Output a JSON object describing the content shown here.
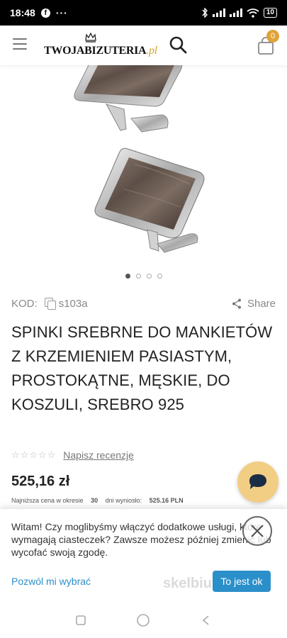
{
  "status": {
    "time": "18:48",
    "fb": "f",
    "more": "···",
    "battery": "10"
  },
  "header": {
    "logo": "TWOJABIZUTERIA",
    "logo_suffix": ".pl",
    "cart_count": "0"
  },
  "carousel": {
    "total": 4,
    "active": 0
  },
  "product": {
    "kod_label": "KOD:",
    "kod_value": "s103a",
    "share_label": "Share",
    "title": "SPINKI SREBRNE DO MANKIETÓW Z KRZEMIENIEM PASIASTYM, PROSTOKĄTNE, MĘSKIE, DO KOSZULI, SREBRO 925",
    "stars": "☆☆☆☆☆",
    "review_link": "Napisz recenzję",
    "price": "525,16 zł",
    "lowest_label": "Najniższa cena w okresie",
    "lowest_days": "30",
    "lowest_middle": "dni wyniosło:",
    "lowest_value": "525.16 PLN"
  },
  "cookie": {
    "text": "Witam! Czy moglibyśmy włączyć dodatkowe usługi, które wymagają ciasteczek? Zawsze możesz później zmienić lub wycofać swoją zgodę.",
    "choose_label": "Pozwól mi wybrać",
    "ok_label": "To jest ok"
  },
  "watermark": "skelbiu.lt",
  "colors": {
    "accent": "#e0a33a",
    "link": "#2b8fc9",
    "chat": "#f2cd84"
  }
}
